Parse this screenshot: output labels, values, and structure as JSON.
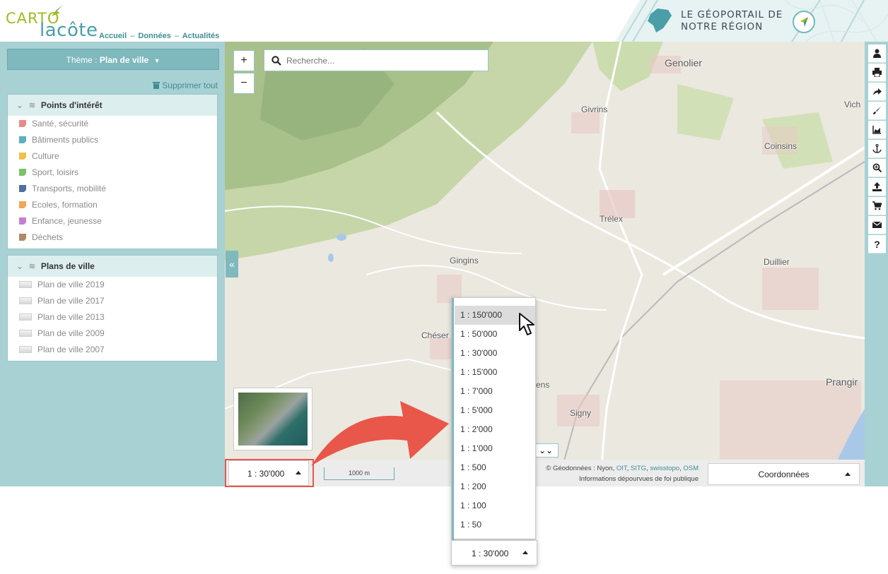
{
  "header": {
    "logo_carto": "CARTO",
    "logo_cote": "lacôte",
    "nav": [
      "Accueil",
      "Données",
      "Actualités"
    ],
    "nav_separator": "–",
    "banner_line1": "LE GÉOPORTAIL DE",
    "banner_line2": "NOTRE RÉGION"
  },
  "sidebar": {
    "theme_prefix": "Thème :",
    "theme_value": "Plan de ville",
    "clear_all": "Supprimer tout",
    "collapse_label": "«",
    "groups": [
      {
        "title": "Points d'intérêt",
        "items": [
          {
            "label": "Santé, sécurité",
            "color": "#e88a8a"
          },
          {
            "label": "Bâtiments publics",
            "color": "#5db0c2"
          },
          {
            "label": "Culture",
            "color": "#f0c24a"
          },
          {
            "label": "Sport, loisirs",
            "color": "#7cc06e"
          },
          {
            "label": "Transports, mobilité",
            "color": "#4f6f9e"
          },
          {
            "label": "Ecoles, formation",
            "color": "#f3a65a"
          },
          {
            "label": "Enfance, jeunesse",
            "color": "#c77fcf"
          },
          {
            "label": "Déchets",
            "color": "#b08a6a"
          }
        ]
      },
      {
        "title": "Plans de ville",
        "items": [
          {
            "label": "Plan de ville 2019"
          },
          {
            "label": "Plan de ville 2017"
          },
          {
            "label": "Plan de ville 2013"
          },
          {
            "label": "Plan de ville 2009"
          },
          {
            "label": "Plan de ville 2007"
          }
        ]
      }
    ]
  },
  "map": {
    "zoom_in": "+",
    "zoom_out": "−",
    "search_placeholder": "Recherche...",
    "places": {
      "genolier": "Genolier",
      "givrins": "Givrins",
      "vich": "Vich",
      "coinsins": "Coinsins",
      "trelex": "Trélex",
      "gingins": "Gingins",
      "duillier": "Duillier",
      "cheser": "Chéser",
      "ens": "ens",
      "signy": "Signy",
      "prangins": "Prangir"
    },
    "expand_label": "»",
    "scale_value": "1 : 30'000",
    "scalebar_label": "1000 m",
    "credits_prefix": "© Géodonnées : Nyon,",
    "credits_links": [
      "OIT",
      "SITG",
      "swisstopo",
      "OSM"
    ],
    "credits_line2": "Informations dépourvues de foi publique",
    "coords_label": "Coordonnées"
  },
  "toolbar": {
    "tools": [
      "user-icon",
      "print-icon",
      "share-icon",
      "draw-icon",
      "profile-icon",
      "anchor-icon",
      "zoom-search-icon",
      "upload-icon",
      "cart-icon",
      "mail-icon",
      "help-icon"
    ],
    "help_label": "?"
  },
  "scale_dropdown": {
    "options": [
      "1 : 150'000",
      "1 : 50'000",
      "1 : 30'000",
      "1 : 15'000",
      "1 : 7'000",
      "1 : 5'000",
      "1 : 2'000",
      "1 : 1'000",
      "1 : 500",
      "1 : 200",
      "1 : 100",
      "1 : 50"
    ],
    "highlighted_index": 0,
    "current": "1 : 30'000"
  },
  "colors": {
    "accent": "#7fb8bd",
    "panel": "#a8d1d3",
    "callout": "#e8574a"
  }
}
